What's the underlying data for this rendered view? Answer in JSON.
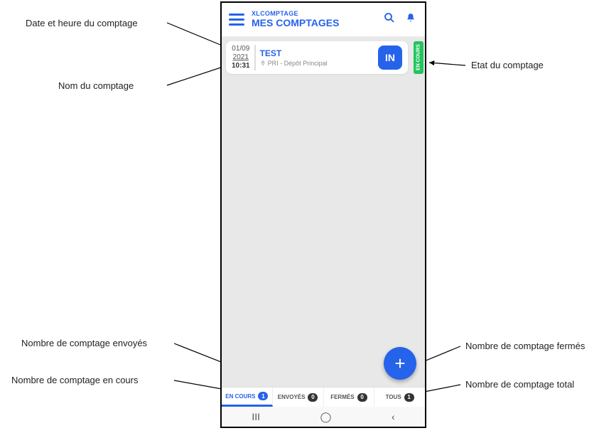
{
  "appbar": {
    "small_title": "XLCOMPTAGE",
    "big_title": "MES COMPTAGES"
  },
  "card": {
    "date": "01/09",
    "year": "2021",
    "time": "10:31",
    "name": "TEST",
    "location": "PRI - Dépôt Principal",
    "in_label": "IN",
    "status_label": "EN COURS"
  },
  "tabs": {
    "en_cours": {
      "label": "EN COURS",
      "count": "1"
    },
    "envoyes": {
      "label": "ENVOYÉS",
      "count": "0"
    },
    "fermes": {
      "label": "FERMÉS",
      "count": "0"
    },
    "tous": {
      "label": "TOUS",
      "count": "1"
    }
  },
  "fab": {
    "glyph": "+"
  },
  "annotations": {
    "date_time": "Date et heure du comptage",
    "nom": "Nom du comptage",
    "etat": "Etat du comptage",
    "envoyes": "Nombre de comptage envoyés",
    "en_cours": "Nombre de comptage en cours",
    "fermes": "Nombre de comptage fermés",
    "total": "Nombre de comptage total"
  }
}
